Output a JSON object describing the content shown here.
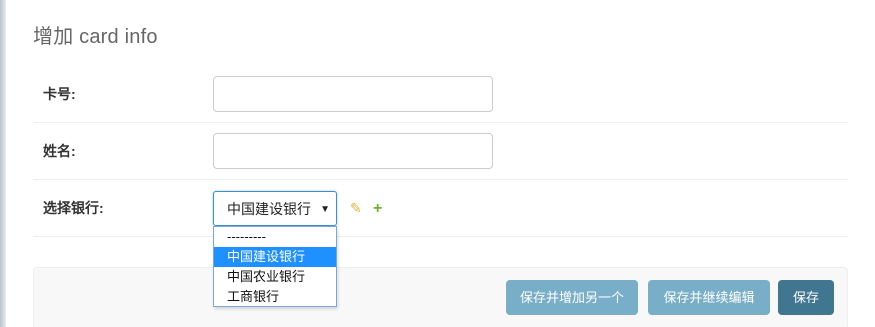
{
  "page": {
    "title": "增加 card info"
  },
  "form": {
    "card_number": {
      "label": "卡号:",
      "value": "",
      "placeholder": ""
    },
    "name": {
      "label": "姓名:",
      "value": "",
      "placeholder": ""
    },
    "bank": {
      "label": "选择银行:",
      "selected_value": "中国建设银行",
      "arrow": "▼",
      "edit_icon": "pencil-icon",
      "add_icon": "plus-icon",
      "edit_glyph": "✎",
      "add_glyph": "+",
      "options": [
        "---------",
        "中国建设银行",
        "中国农业银行",
        "工商银行"
      ],
      "highlighted_option": "中国建设银行"
    }
  },
  "submit": {
    "save_and_add_another": "保存并增加另一个",
    "save_and_continue": "保存并继续编辑",
    "save": "保存"
  },
  "colors": {
    "primary_button": "#417690",
    "secondary_button": "#79aec8",
    "focus_border": "#3e8ed0",
    "option_highlight": "#1e90ff",
    "edit_icon": "#e0b43a",
    "add_icon": "#6cb02b"
  }
}
